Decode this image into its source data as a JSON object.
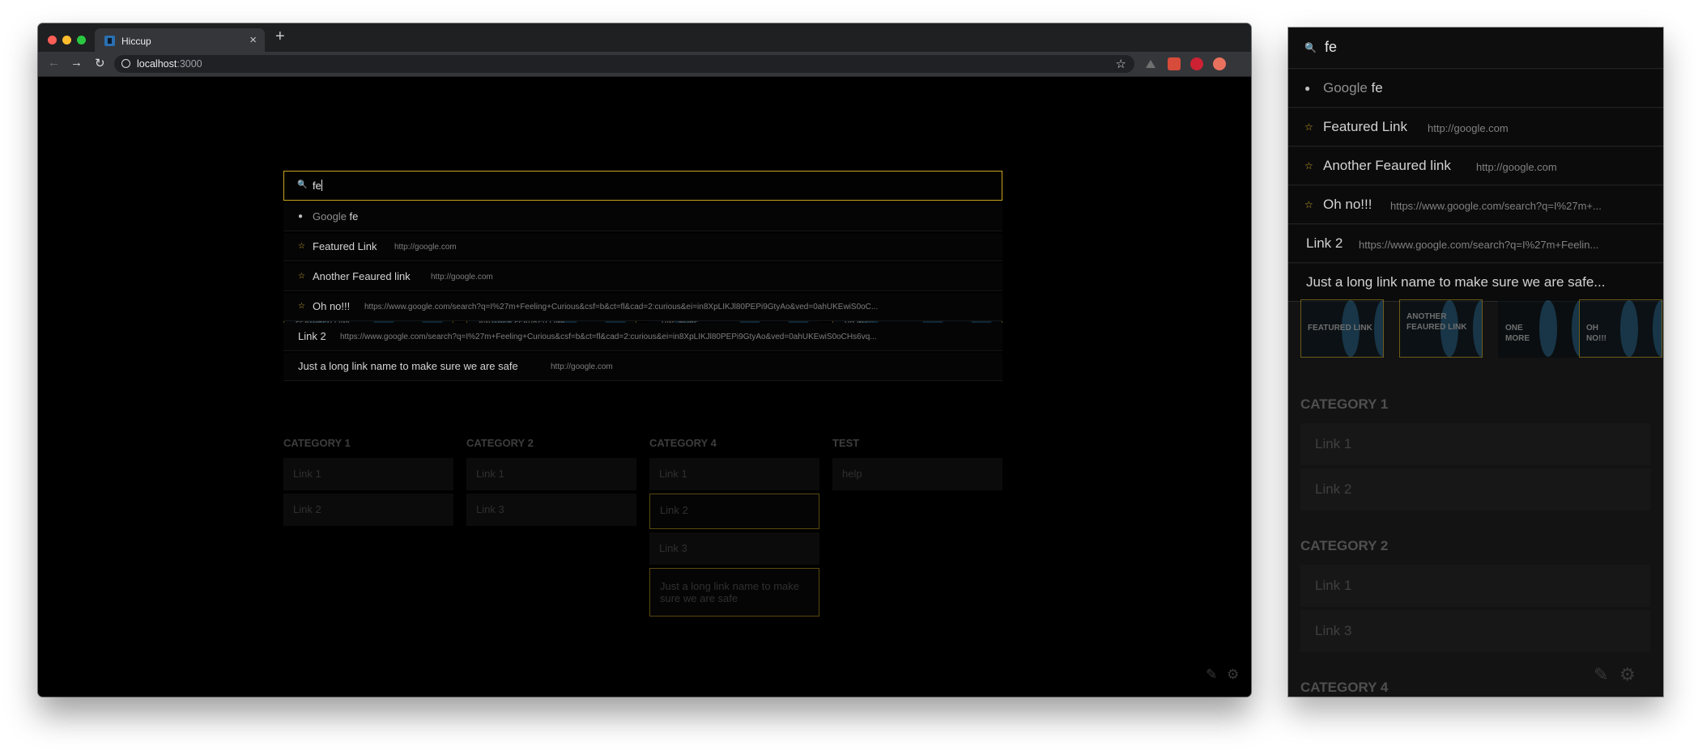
{
  "browser": {
    "tab_title": "Hiccup",
    "tab_close": "×",
    "new_tab": "+",
    "url_host": "localhost",
    "url_port": ":3000",
    "nav": {
      "back": "←",
      "forward": "→",
      "reload": "↻",
      "star": "☆"
    }
  },
  "search": {
    "icon": "search-icon",
    "glyph": "🔍",
    "query": "fe"
  },
  "suggestions": [
    {
      "icon": "globe-icon",
      "glyph": "●",
      "label_prefix": "Google ",
      "label_query": "fe",
      "url": ""
    },
    {
      "icon": "star-icon",
      "glyph": "☆",
      "label": "Featured Link",
      "url": "http://google.com"
    },
    {
      "icon": "star-icon",
      "glyph": "☆",
      "label": "Another Feaured link",
      "url": "http://google.com"
    },
    {
      "icon": "star-icon",
      "glyph": "☆",
      "label": "Oh no!!!",
      "url": "https://www.google.com/search?q=I%27m+Feeling+Curious&csf=b&ct=fl&cad=2:curious&ei=in8XpLIKJl80PEPi9GtyAo&ved=0ahUKEwiS0oC..."
    },
    {
      "icon": "",
      "glyph": "",
      "label": "Link 2",
      "url": "https://www.google.com/search?q=I%27m+Feeling+Curious&csf=b&ct=fl&cad=2:curious&ei=in8XpLIKJl80PEPi9GtyAo&ved=0ahUKEwiS0oCHs6vq..."
    },
    {
      "icon": "",
      "glyph": "",
      "label": "Just a long link name to make sure we are safe",
      "url": "http://google.com"
    }
  ],
  "featured_tiles": [
    {
      "label": "Featured Link",
      "highlighted": true
    },
    {
      "label": "Another Feaured link",
      "highlighted": true
    },
    {
      "label": "One more",
      "highlighted": false
    },
    {
      "label": "Oh no!!!",
      "highlighted": true
    }
  ],
  "categories": [
    {
      "title": "Category 1",
      "links": [
        "Link 1",
        "Link 2"
      ]
    },
    {
      "title": "Category 2",
      "links": [
        "Link 1",
        "Link 3"
      ]
    },
    {
      "title": "Category 4",
      "links": [
        "Link 1",
        "Link 2",
        "Link 3",
        "Just a long link name to make sure we are safe"
      ]
    },
    {
      "title": "Test",
      "links": [
        "help"
      ]
    }
  ],
  "corner_icons": {
    "edit": "✎",
    "settings": "⚙"
  },
  "mobile": {
    "search_query": "fe",
    "suggestions": [
      {
        "label_prefix": "Google ",
        "label_query": "fe",
        "url": ""
      },
      {
        "label": "Featured Link",
        "url": "http://google.com"
      },
      {
        "label": "Another Feaured link",
        "url": "http://google.com"
      },
      {
        "label": "Oh no!!!",
        "url": "https://www.google.com/search?q=I%27m+..."
      },
      {
        "label": "Link 2",
        "url": "https://www.google.com/search?q=I%27m+Feelin..."
      },
      {
        "label": "Just a long link name to make sure we are safe...",
        "url": ""
      }
    ],
    "tiles": [
      "Featured Link",
      "Another Feaured link",
      "One more",
      "Oh no!!!"
    ],
    "categories": [
      {
        "title": "Category 1",
        "links": [
          "Link 1",
          "Link 2"
        ]
      },
      {
        "title": "Category 2",
        "links": [
          "Link 1",
          "Link 3"
        ]
      },
      {
        "title": "Category 4",
        "links": []
      }
    ]
  },
  "colors": {
    "accent": "#c9a320",
    "background": "#000000",
    "panel": "#131313",
    "stripe": "#1e5a7e"
  }
}
